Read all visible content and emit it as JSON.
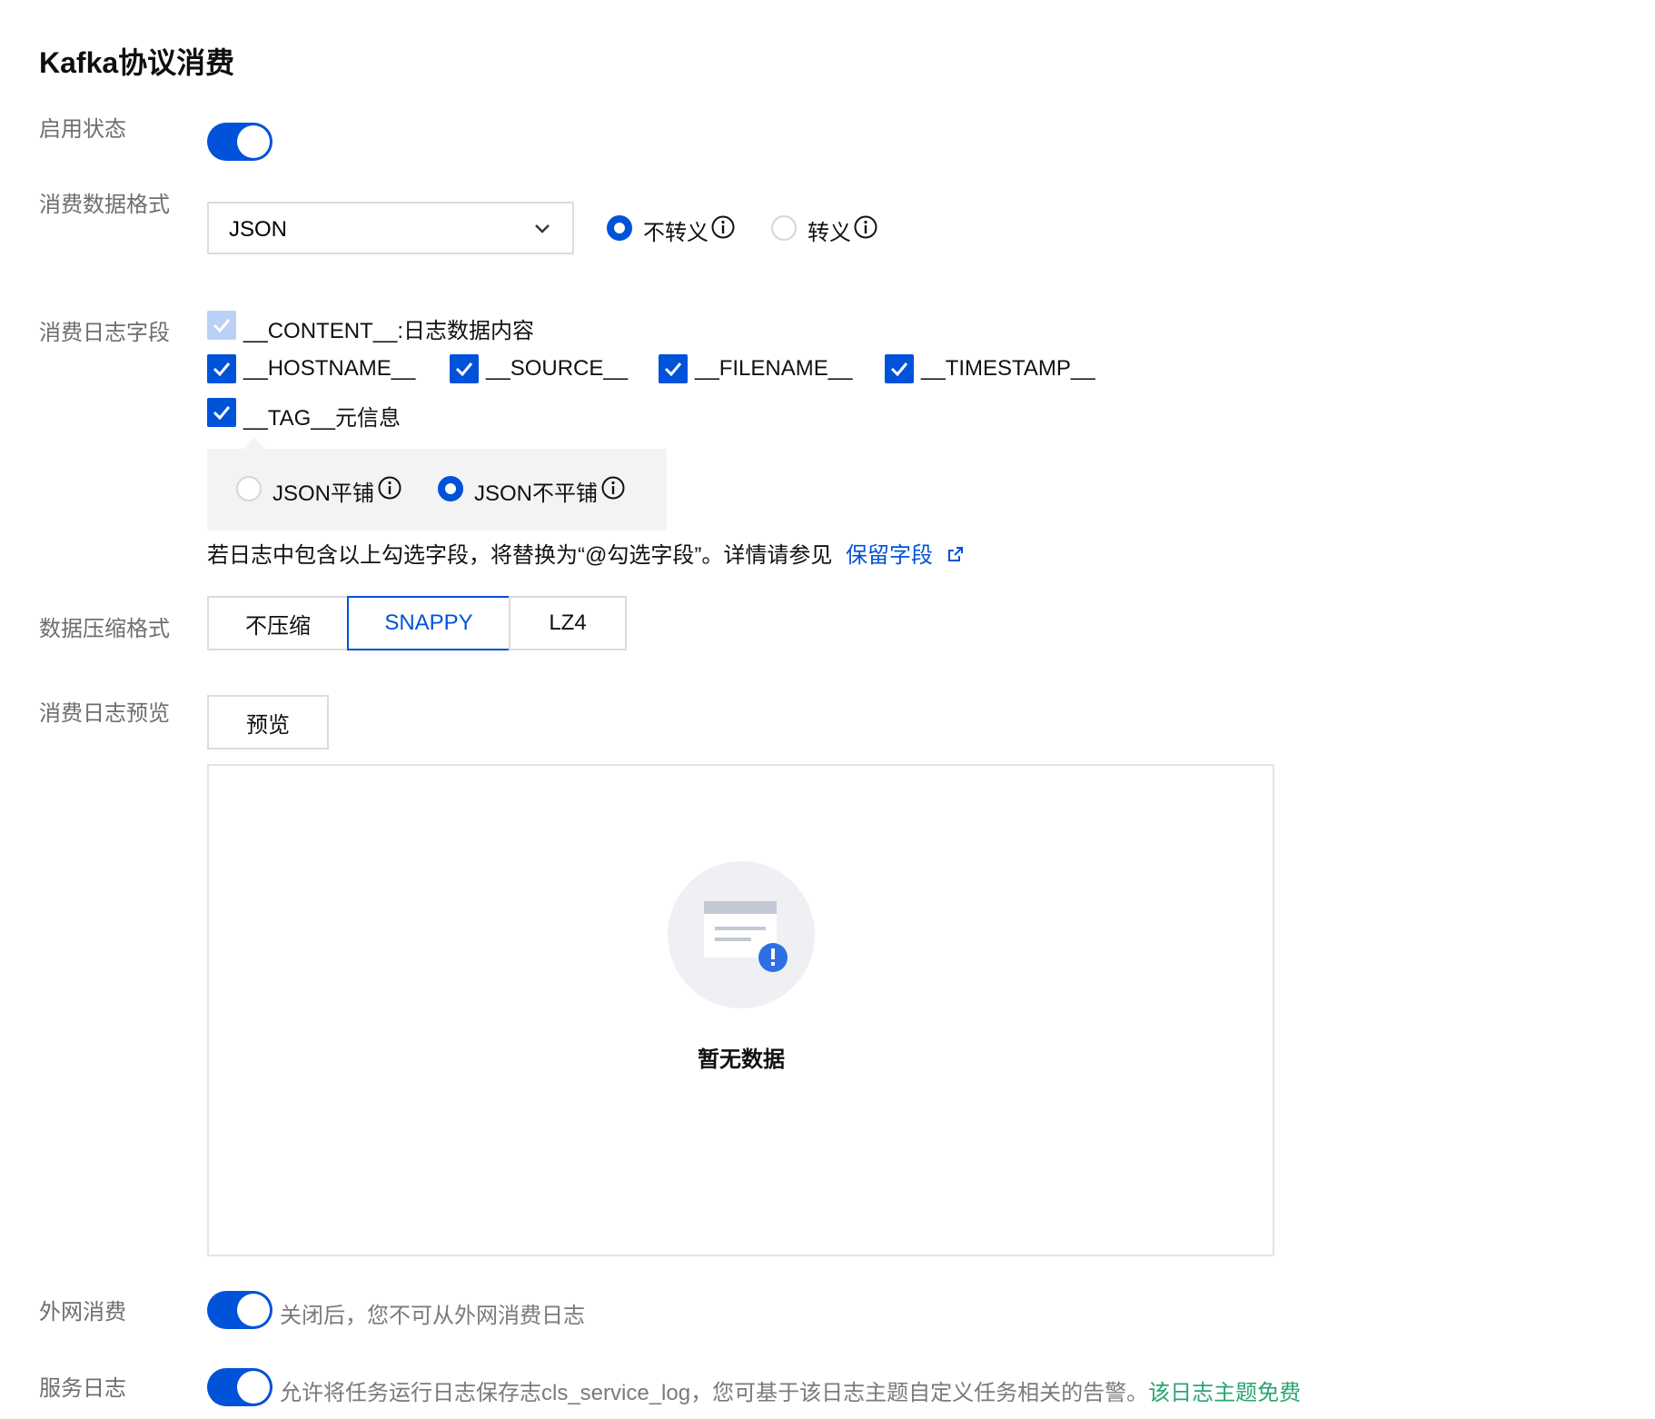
{
  "page": {
    "title": "Kafka协议消费"
  },
  "enable": {
    "label": "启用状态",
    "on": true
  },
  "format": {
    "label": "消费数据格式",
    "selected": "JSON",
    "escape_options": [
      {
        "label": "不转义",
        "selected": true
      },
      {
        "label": "转义",
        "selected": false
      }
    ]
  },
  "fields": {
    "label": "消费日志字段",
    "content": {
      "label": "__CONTENT__:日志数据内容",
      "checked": true,
      "disabled": true
    },
    "hostname": {
      "label": "__HOSTNAME__",
      "checked": true
    },
    "source": {
      "label": "__SOURCE__",
      "checked": true
    },
    "filename": {
      "label": "__FILENAME__",
      "checked": true
    },
    "timestamp": {
      "label": "__TIMESTAMP__",
      "checked": true
    },
    "tag": {
      "label": "__TAG__元信息",
      "checked": true
    },
    "tag_options": [
      {
        "label": "JSON平铺",
        "selected": false
      },
      {
        "label": "JSON不平铺",
        "selected": true
      }
    ],
    "note": "若日志中包含以上勾选字段，将替换为“@勾选字段”。详情请参见",
    "note_link": "保留字段"
  },
  "compression": {
    "label": "数据压缩格式",
    "options": [
      "不压缩",
      "SNAPPY",
      "LZ4"
    ],
    "selected": "SNAPPY"
  },
  "preview": {
    "label": "消费日志预览",
    "button": "预览",
    "empty_text": "暂无数据"
  },
  "public_network": {
    "label": "外网消费",
    "on": true,
    "desc": "关闭后，您不可从外网消费日志"
  },
  "service_log": {
    "label": "服务日志",
    "on": true,
    "desc": "允许将任务运行日志保存志cls_service_log，您可基于该日志主题自定义任务相关的告警。",
    "free_note": "该日志主题免费"
  },
  "colors": {
    "primary": "#0052d9",
    "success": "#2ba471",
    "label_gray": "#6e6e6e"
  },
  "icons": [
    "chevron-down-icon",
    "info-icon",
    "check-icon",
    "external-link-icon",
    "empty-data-icon"
  ]
}
